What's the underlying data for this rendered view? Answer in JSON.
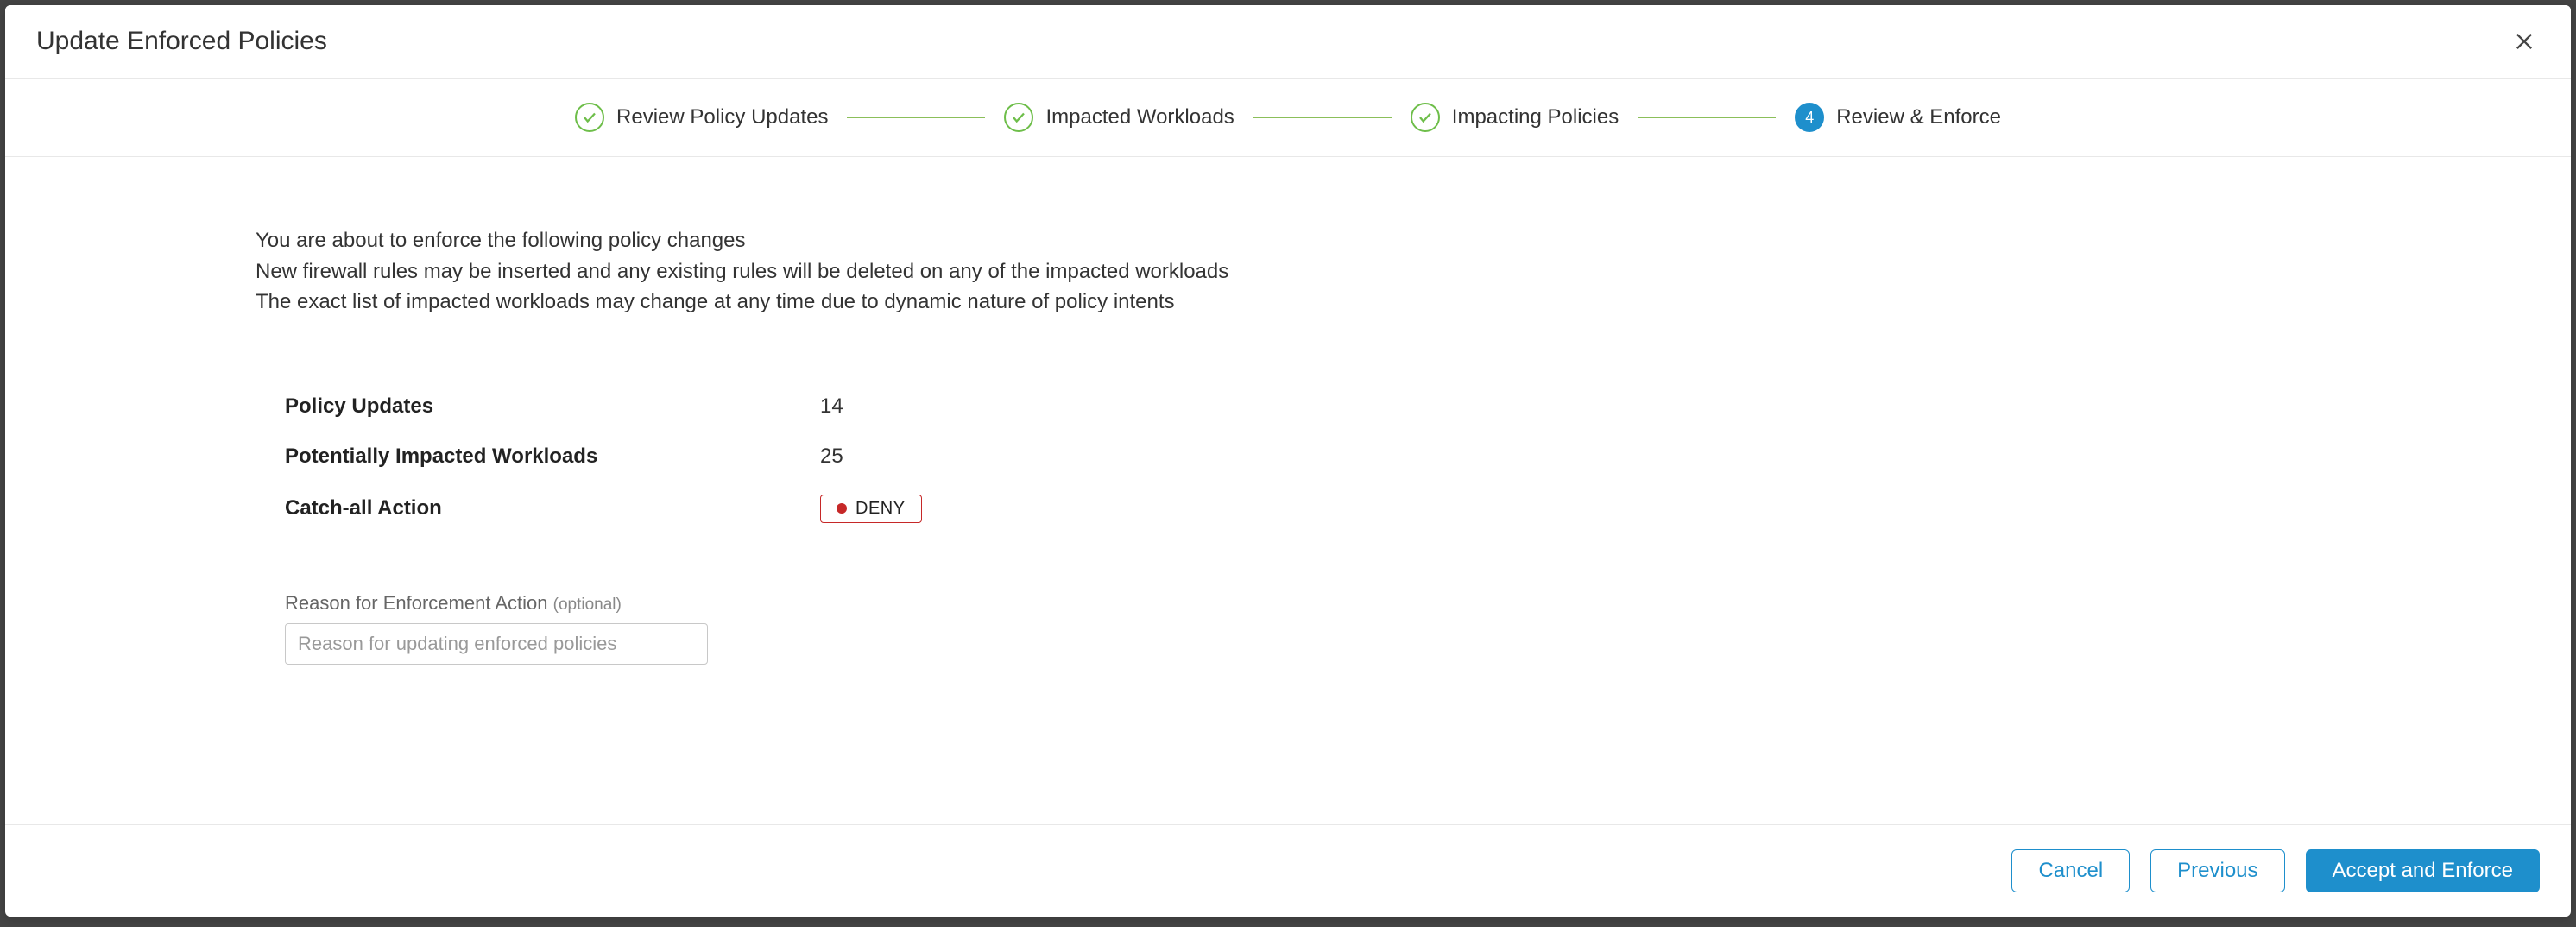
{
  "modal": {
    "title": "Update Enforced Policies"
  },
  "stepper": {
    "steps": [
      {
        "label": "Review Policy Updates",
        "state": "done"
      },
      {
        "label": "Impacted Workloads",
        "state": "done"
      },
      {
        "label": "Impacting Policies",
        "state": "done"
      },
      {
        "label": "Review & Enforce",
        "state": "current",
        "number": "4"
      }
    ]
  },
  "intro": {
    "line1": "You are about to enforce the following policy changes",
    "line2": "New firewall rules may be inserted and any existing rules will be deleted on any of the impacted workloads",
    "line3": "The exact list of impacted workloads may change at any time due to dynamic nature of policy intents"
  },
  "summary": {
    "policy_updates_label": "Policy Updates",
    "policy_updates_value": "14",
    "impacted_workloads_label": "Potentially Impacted Workloads",
    "impacted_workloads_value": "25",
    "catch_all_label": "Catch-all Action",
    "catch_all_value": "DENY"
  },
  "reason": {
    "label": "Reason for Enforcement Action ",
    "optional": "(optional)",
    "placeholder": "Reason for updating enforced policies"
  },
  "footer": {
    "cancel": "Cancel",
    "previous": "Previous",
    "accept": "Accept and Enforce"
  }
}
